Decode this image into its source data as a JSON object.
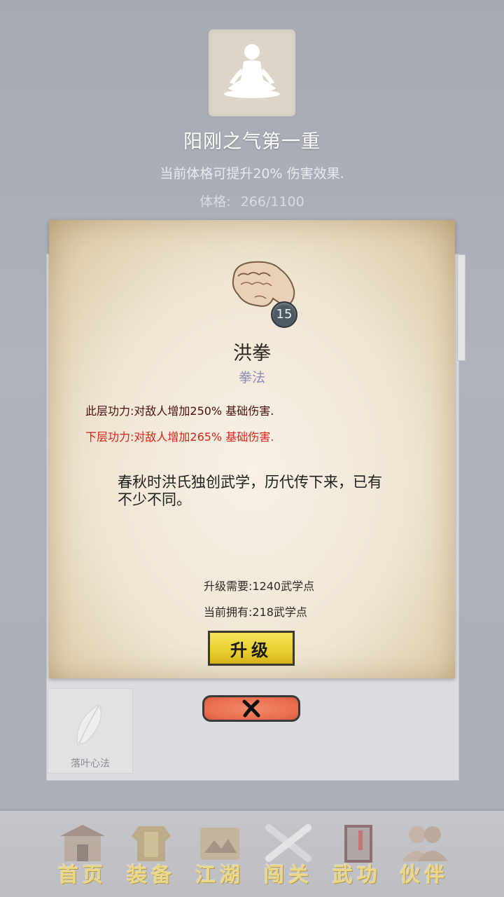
{
  "header": {
    "avatar_icon": "meditating-figure-icon",
    "realm_title": "阳刚之气第一重",
    "realm_desc": "当前体格可提升20% 伤害效果.",
    "stat_label": "体格:",
    "stat_value": "266/1100"
  },
  "skill_list": {
    "tiles": [
      {
        "label": "落叶心法",
        "icon": "leaf-icon"
      }
    ]
  },
  "detail": {
    "icon": "fist-icon",
    "level": "15",
    "name": "洪拳",
    "type": "拳法",
    "effect_current": "此层功力:对敌人增加250% 基础伤害.",
    "effect_next": "下层功力:对敌人增加265% 基础伤害.",
    "lore": "春秋时洪氏独创武学，历代传下来，已有不少不同。",
    "requirement": "升级需要:1240武学点",
    "owned": "当前拥有:218武学点",
    "upgrade_label": "升级",
    "close_icon": "close-icon"
  },
  "nav": {
    "items": [
      {
        "label": "首页",
        "icon": "building-icon"
      },
      {
        "label": "装备",
        "icon": "armor-icon"
      },
      {
        "label": "江湖",
        "icon": "scroll-map-icon"
      },
      {
        "label": "闯关",
        "icon": "crossed-swords-icon"
      },
      {
        "label": "武功",
        "icon": "book-icon"
      },
      {
        "label": "伙伴",
        "icon": "partners-icon"
      }
    ]
  },
  "colors": {
    "effect_next": "#e0201a",
    "effect_current": "#4a1010",
    "skill_type": "#8f8cb8",
    "upgrade_button": "#e9cf2e",
    "close_button": "#ea6d4f",
    "nav_label": "#f3dc7c"
  }
}
